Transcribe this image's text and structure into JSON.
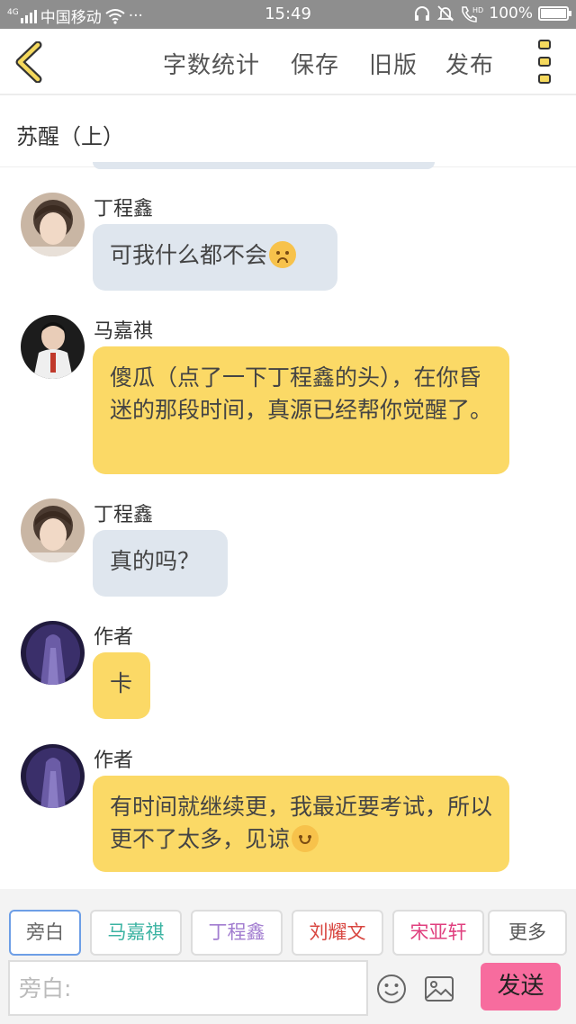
{
  "status_bar": {
    "signal_text": "4G",
    "carrier": "中国移动",
    "more": "···",
    "time": "15:49",
    "battery": "100%",
    "battery_level": 1.0
  },
  "toolbar": {
    "word_count": "字数统计",
    "save": "保存",
    "old_version": "旧版",
    "publish": "发布"
  },
  "story": {
    "title": "苏醒（上）"
  },
  "messages": [
    {
      "sender": "丁程鑫",
      "text": "可我什么都不会",
      "emoji": "sad-emoji"
    },
    {
      "sender": "马嘉祺",
      "text": "傻瓜（点了一下丁程鑫的头），在你昏迷的那段时间，真源已经帮你觉醒了。"
    },
    {
      "sender": "丁程鑫",
      "text": "真的吗？"
    },
    {
      "sender": "作者",
      "text": "卡"
    },
    {
      "sender": "作者",
      "text": "有时间就继续更，我最近要考试，所以更不了太多，见谅",
      "emoji": "wink-emoji"
    }
  ],
  "roles": [
    {
      "label": "旁白",
      "color": "#666666"
    },
    {
      "label": "马嘉祺",
      "color": "#3bb3a2"
    },
    {
      "label": "丁程鑫",
      "color": "#a27dd0"
    },
    {
      "label": "刘耀文",
      "color": "#d8453f"
    },
    {
      "label": "宋亚轩",
      "color": "#e0407f"
    },
    {
      "label": "更多",
      "color": "#555555"
    }
  ],
  "composer": {
    "placeholder": "旁白:",
    "send": "发送"
  },
  "colors": {
    "bubble_gray": "#dfe6ee",
    "bubble_yellow": "#fbd966",
    "send_button": "#f76c9e",
    "status_bar": "#8e8e8e"
  }
}
